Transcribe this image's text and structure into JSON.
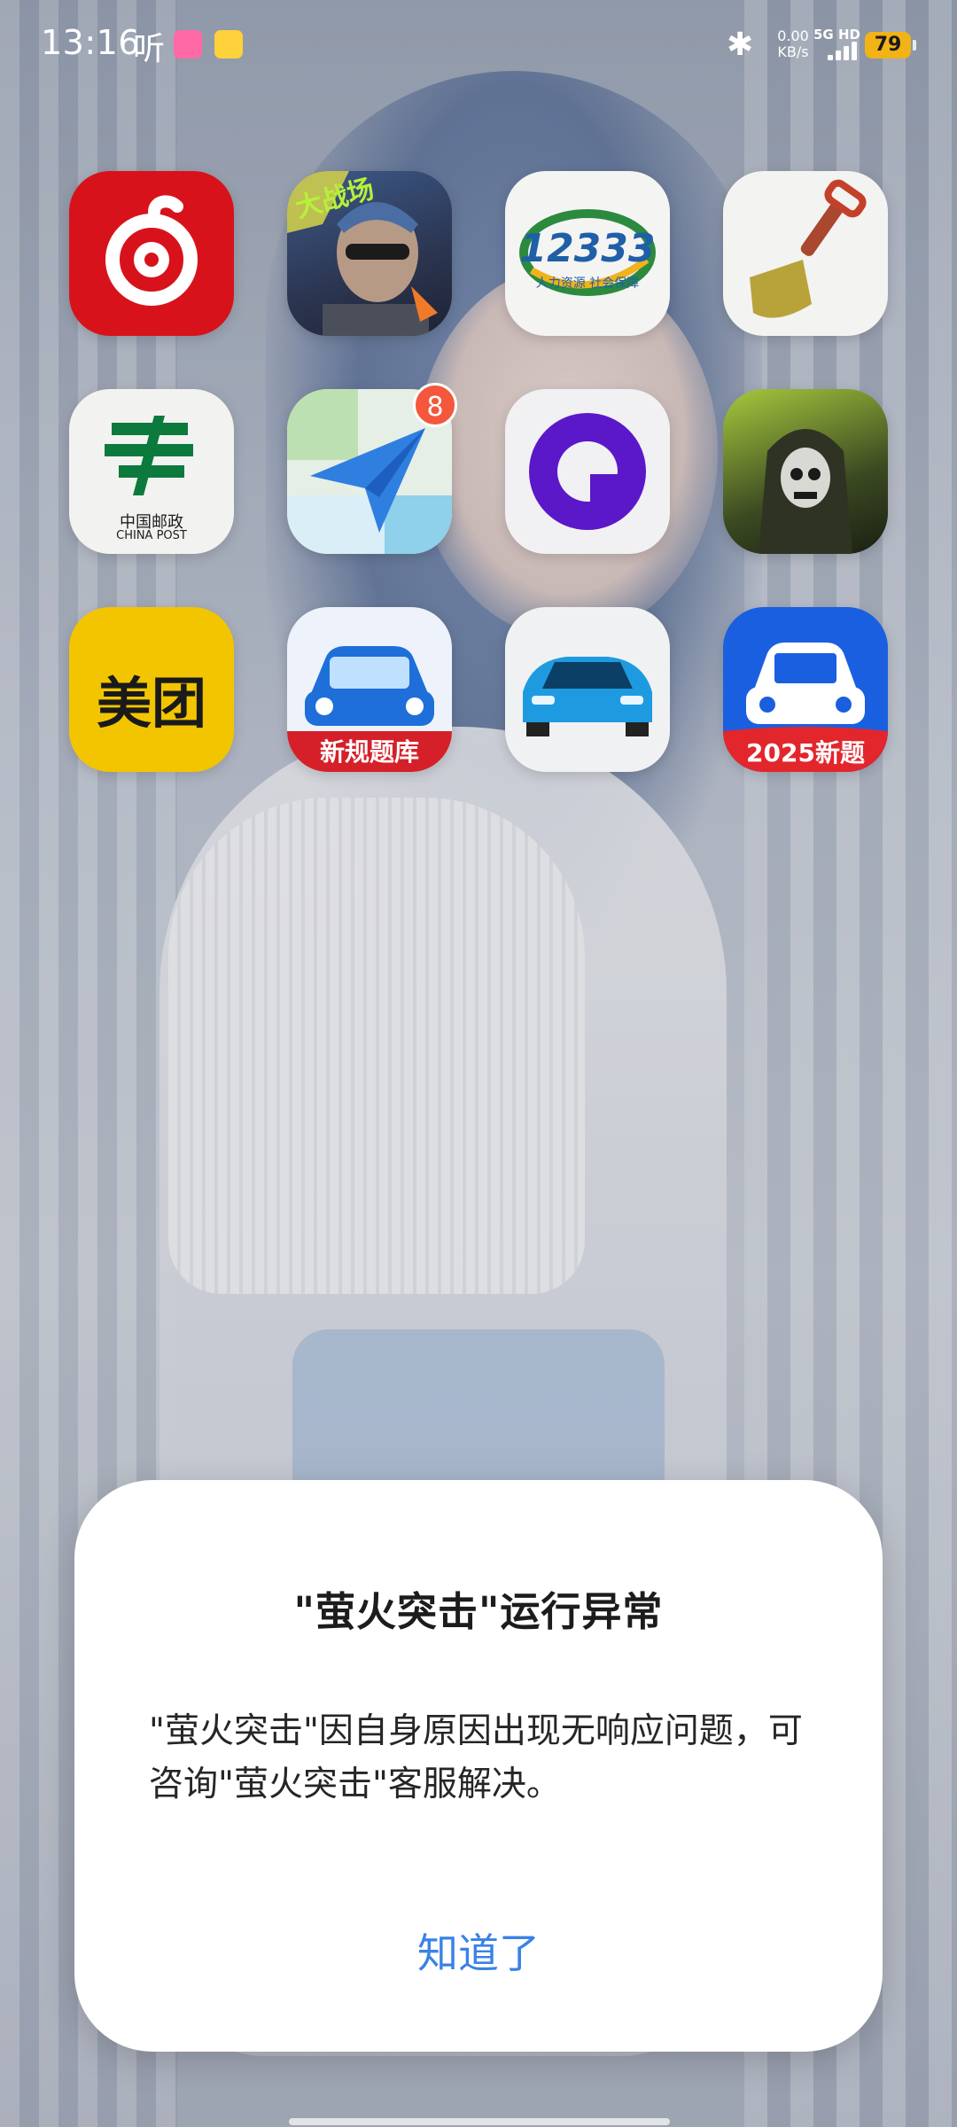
{
  "status_bar": {
    "time": "13:16",
    "listen_label": "听",
    "net_speed_value": "0.00",
    "net_speed_unit": "KB/s",
    "network_type": "5G HD",
    "battery_level": "79",
    "battery_color": "#f2b316",
    "icons": [
      "bilibili-icon",
      "notification-app-icon",
      "bluetooth-icon",
      "signal-icon",
      "battery-icon"
    ]
  },
  "apps": [
    {
      "name": "netease-music-app",
      "icon": "music-note-icon",
      "badge": null
    },
    {
      "name": "game-battle-app",
      "icon": "soldier-portrait-icon",
      "label": "大战场",
      "badge": null
    },
    {
      "name": "social-security-12333-app",
      "icon": "12333-logo-icon",
      "label": "12333",
      "sublabel": "人力资源 社会保障",
      "badge": null
    },
    {
      "name": "shovel-app",
      "icon": "shovel-icon",
      "badge": null
    },
    {
      "name": "china-post-app",
      "icon": "china-post-logo-icon",
      "label": "中国邮政",
      "sublabel": "CHINA POST",
      "badge": null
    },
    {
      "name": "maps-navigation-app",
      "icon": "paper-plane-map-icon",
      "badge": "8"
    },
    {
      "name": "purple-circle-app",
      "icon": "chat-circle-icon",
      "badge": null
    },
    {
      "name": "shooter-game-app",
      "icon": "masked-soldier-icon",
      "badge": null
    },
    {
      "name": "meituan-app",
      "icon": "meituan-logo-icon",
      "label": "美团",
      "badge": null
    },
    {
      "name": "driving-test-app",
      "icon": "blue-car-icon",
      "label": "新规题库",
      "badge": null
    },
    {
      "name": "car-sport-app",
      "icon": "sport-car-icon",
      "badge": null
    },
    {
      "name": "driving-exam-2025-app",
      "icon": "white-car-icon",
      "label": "2025新题",
      "badge": null
    }
  ],
  "dialog": {
    "title": "\"萤火突击\"运行异常",
    "message": "\"萤火突击\"因自身原因出现无响应问题，可咨询\"萤火突击\"客服解决。",
    "confirm_label": "知道了",
    "confirm_color": "#3a82e6"
  }
}
